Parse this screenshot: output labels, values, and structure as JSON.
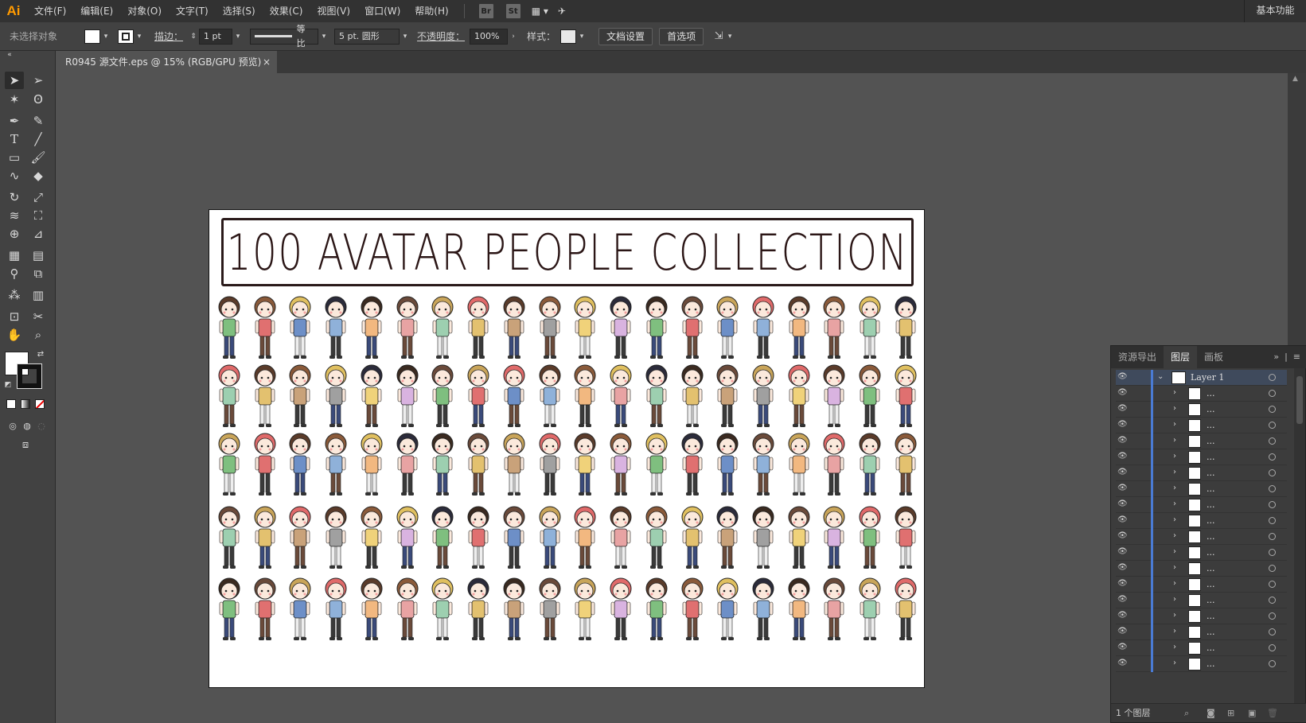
{
  "app": {
    "logo": "Ai",
    "workspace": "基本功能"
  },
  "menu": [
    "文件(F)",
    "编辑(E)",
    "对象(O)",
    "文字(T)",
    "选择(S)",
    "效果(C)",
    "视图(V)",
    "窗口(W)",
    "帮助(H)"
  ],
  "app_buttons": {
    "bridge": "Br",
    "stock": "St"
  },
  "control": {
    "selection": "未选择对象",
    "stroke_label": "描边：",
    "stroke_weight": "1 pt",
    "stroke_profile": "等比",
    "brush": "5 pt. 圆形",
    "opacity_label": "不透明度：",
    "opacity": "100%",
    "style_label": "样式：",
    "doc_setup": "文档设置",
    "preferences": "首选项"
  },
  "document": {
    "tab_title": "R0945 源文件.eps @ 15% (RGB/GPU 预览)",
    "close": "×"
  },
  "artboard": {
    "title": "100 AVATAR PEOPLE COLLECTION",
    "rows": 5,
    "per_row": 20
  },
  "layers_panel": {
    "tabs": [
      "资源导出",
      "图层",
      "画板"
    ],
    "active_tab": "图层",
    "top_layer": "Layer 1",
    "sublayer_name": "...",
    "sublayer_count": 18,
    "footer": "1 个图层"
  },
  "colors": {
    "accent": "#ff9a00",
    "selection_bar": "#4a7bd4"
  }
}
